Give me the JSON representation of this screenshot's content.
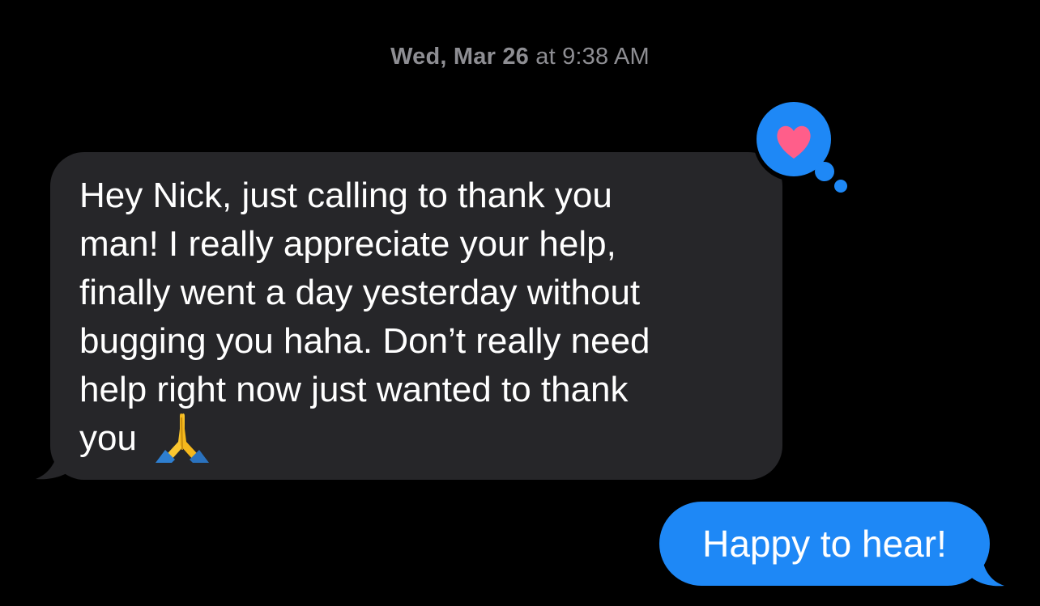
{
  "conversation": {
    "timestamp": {
      "date": "Wed, Mar 26",
      "time": "at 9:38 AM"
    },
    "messages": [
      {
        "direction": "received",
        "text": "Hey Nick, just calling to thank you\nman! I really appreciate your help,\nfinally went a day yesterday without\nbugging you haha. Don’t really need\nhelp right now just wanted to thank\nyou",
        "trailing_emoji": "folded-hands-emoji",
        "reaction": "heart-icon"
      },
      {
        "direction": "sent",
        "text": "Happy to hear!"
      }
    ]
  },
  "colors": {
    "background": "#000000",
    "received_bubble": "#262629",
    "sent_bubble": "#1e88f6",
    "timestamp_text": "#8e8e93",
    "heart": "#ff5e8a"
  }
}
